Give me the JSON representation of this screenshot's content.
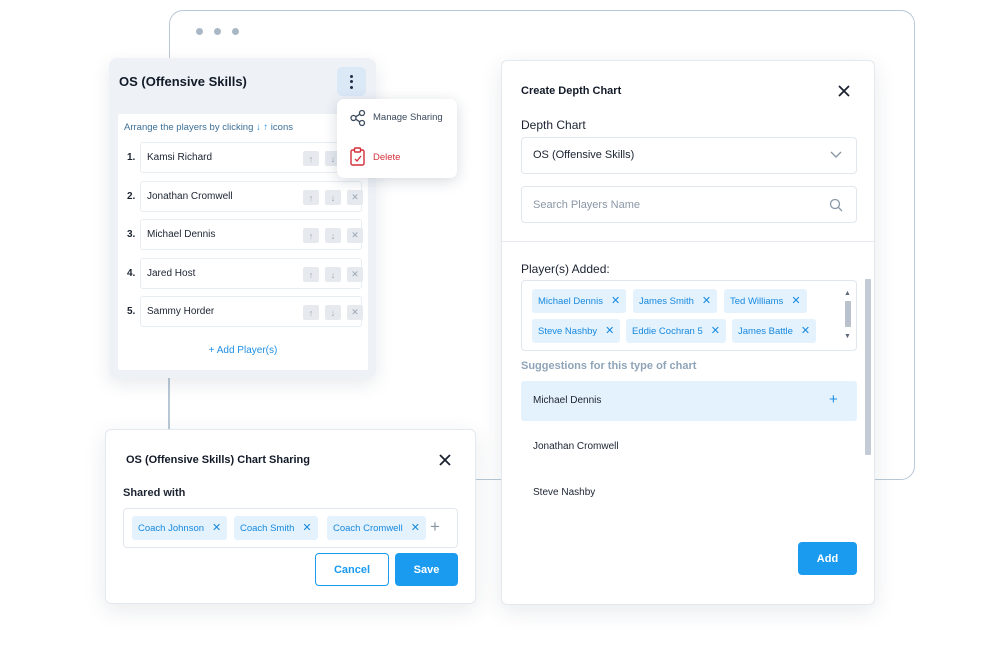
{
  "background_window": {
    "dots": 3
  },
  "depth_chart_card": {
    "title": "OS (Offensive Skills)",
    "menu_icon": "kebab-icon",
    "hint_prefix": "Arrange the players by clicking",
    "hint_arrows": "↓ ↑",
    "hint_suffix": "icons",
    "players": [
      {
        "num": "1.",
        "name": "Kamsi Richard"
      },
      {
        "num": "2.",
        "name": "Jonathan Cromwell"
      },
      {
        "num": "3.",
        "name": "Michael Dennis"
      },
      {
        "num": "4.",
        "name": "Jared Host"
      },
      {
        "num": "5.",
        "name": "Sammy Horder"
      }
    ],
    "add_player": "+ Add Player(s)"
  },
  "context_menu": {
    "items": [
      {
        "label": "Manage Sharing",
        "icon": "share-icon",
        "color": "#3b4a5c"
      },
      {
        "label": "Delete",
        "icon": "clipboard-delete-icon",
        "color": "#d32f3a"
      }
    ]
  },
  "create_depth_chart": {
    "title": "Create Depth Chart",
    "depth_chart_label": "Depth Chart",
    "depth_chart_value": "OS (Offensive Skills)",
    "search_placeholder": "Search Players Name",
    "players_added_label": "Player(s) Added:",
    "added_players": [
      "Michael Dennis",
      "James Smith",
      "Ted Williams",
      "Steve Nashby",
      "Eddie Cochran 5",
      "James Battle"
    ],
    "suggestions_heading": "Suggestions for this type of chart",
    "suggestions": [
      "Michael Dennis",
      "Jonathan Cromwell",
      "Steve Nashby"
    ],
    "add_button": "Add"
  },
  "chart_sharing": {
    "title": "OS (Offensive Skills) Chart Sharing",
    "shared_with_label": "Shared with",
    "coaches": [
      "Coach Johnson",
      "Coach Smith",
      "Coach Cromwell"
    ],
    "cancel_button": "Cancel",
    "save_button": "Save"
  },
  "colors": {
    "accent": "#1a9bef",
    "tag_bg": "#e3f2fd",
    "danger": "#d32f3a",
    "card_bg": "#eef2f7"
  }
}
